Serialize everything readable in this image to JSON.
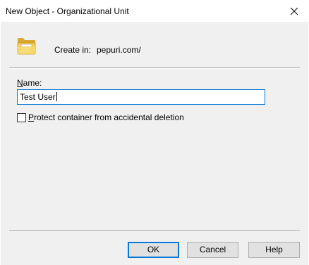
{
  "window": {
    "title": "New Object - Organizational Unit"
  },
  "header": {
    "create_in_label": "Create in:",
    "create_in_value": "pepuri.com/",
    "icon": "folder-icon"
  },
  "form": {
    "name_label_mnemonic": "N",
    "name_label_rest": "ame:",
    "name_value": "Test User",
    "protect_checked": false,
    "protect_label_mnemonic": "P",
    "protect_label_rest": "rotect container from accidental deletion"
  },
  "buttons": {
    "ok": "OK",
    "cancel": "Cancel",
    "help": "Help"
  },
  "colors": {
    "focus_accent": "#0078d7",
    "dialog_background": "#f0f0f0"
  }
}
